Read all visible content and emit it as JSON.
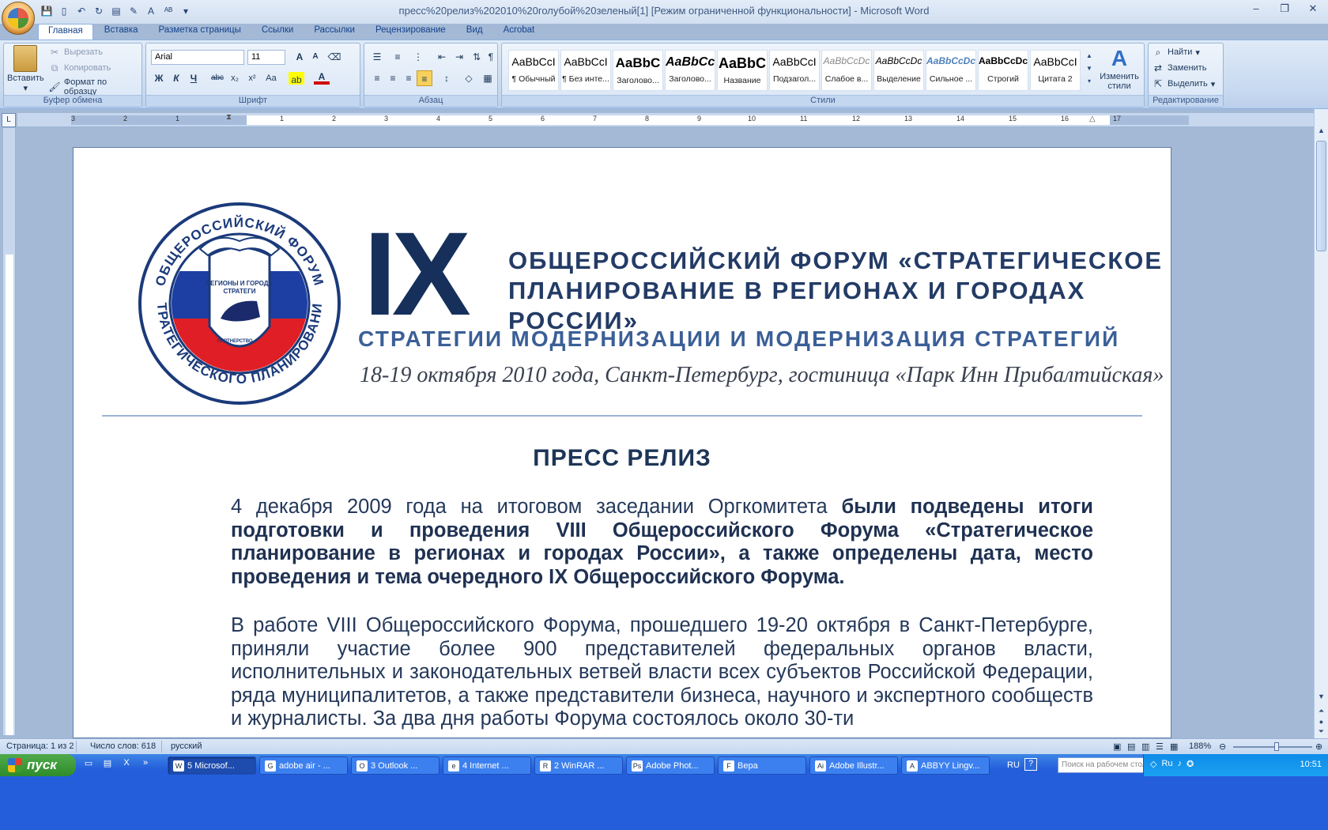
{
  "window": {
    "title": "пресс%20релиз%202010%20голубой%20зеленый[1] [Режим ограниченной функциональности] - Microsoft Word",
    "controls": [
      "–",
      "❐",
      "✕"
    ]
  },
  "ribbon_tabs": [
    "Главная",
    "Вставка",
    "Разметка страницы",
    "Ссылки",
    "Рассылки",
    "Рецензирование",
    "Вид",
    "Acrobat"
  ],
  "clipboard": {
    "paste": "Вставить",
    "cut": "Вырезать",
    "copy": "Копировать",
    "format_painter": "Формат по образцу",
    "label": "Буфер обмена"
  },
  "font": {
    "name": "Arial",
    "size": "11",
    "label": "Шрифт"
  },
  "paragraph": {
    "label": "Абзац"
  },
  "styles": {
    "label": "Стили",
    "items": [
      {
        "sample": "AaBbCcI",
        "name": "¶ Обычный"
      },
      {
        "sample": "AaBbCcI",
        "name": "¶ Без инте..."
      },
      {
        "sample": "AaBbC",
        "name": "Заголово..."
      },
      {
        "sample": "AaBbCc",
        "name": "Заголово..."
      },
      {
        "sample": "AaBbC",
        "name": "Название"
      },
      {
        "sample": "AaBbCcI",
        "name": "Подзагол..."
      },
      {
        "sample": "AaBbCcDc",
        "name": "Слабое в..."
      },
      {
        "sample": "AaBbCcDc",
        "name": "Выделение"
      },
      {
        "sample": "AaBbCcDc",
        "name": "Сильное ..."
      },
      {
        "sample": "AaBbCcDc",
        "name": "Строгий"
      },
      {
        "sample": "AaBbCcI",
        "name": "Цитата 2"
      }
    ],
    "change": "Изменить стили"
  },
  "editing": {
    "label": "Редактирование",
    "find": "Найти",
    "replace": "Заменить",
    "select": "Выделить"
  },
  "ruler": {
    "left": [
      "3",
      "2",
      "1"
    ],
    "right": [
      "1",
      "2",
      "3",
      "4",
      "5",
      "6",
      "7",
      "8",
      "9",
      "10",
      "11",
      "12",
      "13",
      "14",
      "15",
      "16",
      "17"
    ]
  },
  "document": {
    "logo": {
      "top_arc": "ОБЩЕРОССИЙСКИЙ ФОРУМ",
      "bottom_arc": "СТРАТЕГИЧЕСКОГО ПЛАНИРОВАНИЯ",
      "shield_top": "РЕГИОНЫ И ГОРОДА",
      "shield_mid": "СТРАТЕГИ",
      "shield_bottom": "ПАРТНЕРСТВО"
    },
    "roman": "IX",
    "forum_title_1": "ОБЩЕРОССИЙСКИЙ ФОРУМ «СТРАТЕГИЧЕСКОЕ",
    "forum_title_2": "ПЛАНИРОВАНИЕ В РЕГИОНАХ И ГОРОДАХ РОССИИ»",
    "subhead": "СТРАТЕГИИ МОДЕРНИЗАЦИИ И МОДЕРНИЗАЦИЯ СТРАТЕГИЙ",
    "dateline": "18-19 октября 2010 года, Санкт-Петербург, гостиница «Парк Инн Прибалтийская»",
    "press_title": "ПРЕСС РЕЛИЗ",
    "p1_plain": "4 декабря 2009 года на итоговом заседании Оргкомитета ",
    "p1_bold": "были подведены итоги подготовки и проведения VIII Общероссийского Форума «Стратегическое планирование в регионах и городах России», а также определены дата, место проведения и тема очередного IX  Общероссийского Форума.",
    "p2": "В работе VIII Общероссийского Форума, прошедшего 19-20 октября в Санкт-Петербурге, приняли участие более 900 представителей федеральных органов власти, исполнительных и законодательных ветвей власти всех субъектов Российской Федерации, ряда муниципалитетов, а также представители бизнеса, научного и экспертного сообществ и журналисты. За два дня работы Форума состоялось около 30-ти"
  },
  "status": {
    "page": "Страница: 1 из 2",
    "words": "Число слов: 618",
    "language": "русский",
    "zoom": "188%"
  },
  "taskbar": {
    "start": "пуск",
    "tasks": [
      {
        "icon": "W",
        "label": "5 Microsof..."
      },
      {
        "icon": "G",
        "label": "adobe air - ..."
      },
      {
        "icon": "O",
        "label": "3 Outlook ..."
      },
      {
        "icon": "e",
        "label": "4 Internet ..."
      },
      {
        "icon": "R",
        "label": "2 WinRAR ..."
      },
      {
        "icon": "Ps",
        "label": "Adobe Phot..."
      },
      {
        "icon": "F",
        "label": "Вера"
      },
      {
        "icon": "Ai",
        "label": "Adobe Illustr..."
      },
      {
        "icon": "A",
        "label": "ABBYY Lingv..."
      }
    ],
    "lang": "RU",
    "search_placeholder": "Поиск на рабочем столе",
    "tray_lang": "Ru",
    "clock": "10:51"
  }
}
